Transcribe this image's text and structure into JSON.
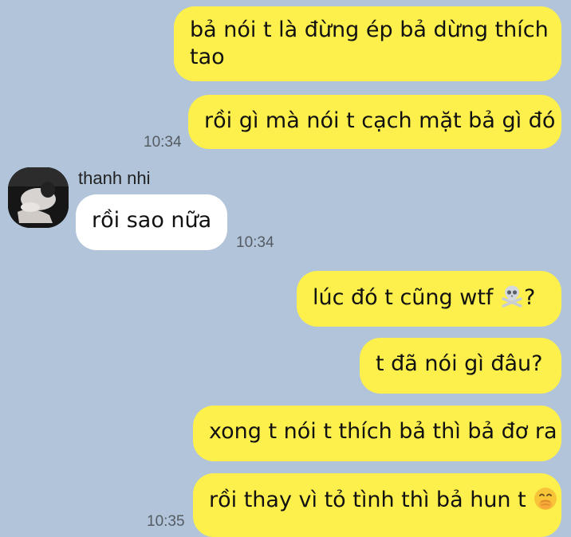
{
  "messages_top": [
    {
      "text_line1": "bả nói t là đừng ép bả dừng thích",
      "text_line2": "tao"
    },
    {
      "text": "rồi gì mà nói t cạch mặt bả gì đó",
      "time": "10:34"
    }
  ],
  "incoming": {
    "sender": "thanh nhi",
    "text": "rồi sao nữa",
    "time": "10:34"
  },
  "messages_bottom": [
    {
      "text_before_emoji": "lúc đó t cũng wtf ",
      "emoji": "skull-and-crossbones-icon",
      "text_after_emoji": "?"
    },
    {
      "text": "t đã nói gì đâu?"
    },
    {
      "text": "xong t nói t thích bả thì bả đơ ra"
    },
    {
      "text": "rồi thay vì tỏ tình thì bả hun t ",
      "emoji": "face-with-hand-over-mouth-icon",
      "time": "10:35"
    }
  ],
  "colors": {
    "background": "#b1c4d9",
    "outgoing_bubble": "#fdf04c",
    "incoming_bubble": "#ffffff",
    "timestamp": "#555b63"
  }
}
